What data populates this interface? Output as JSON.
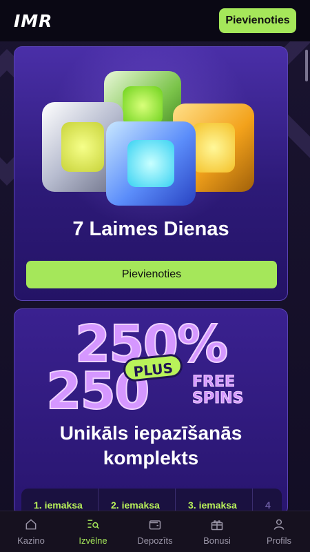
{
  "header": {
    "logo": "IMR",
    "join_label": "Pievienoties"
  },
  "promo1": {
    "title": "7 Laimes Dienas",
    "button_label": "Pievienoties"
  },
  "promo2": {
    "headline_top": "250%",
    "headline_bottom": "250",
    "plus_badge": "PLUS",
    "free_spins_line1": "FREE",
    "free_spins_line2": "SPINS",
    "title_line1": "Unikāls iepazīšanās",
    "title_line2": "komplekts",
    "deposit_tabs": [
      "1. iemaksa",
      "2. iemaksa",
      "3. iemaksa",
      "4"
    ]
  },
  "nav": {
    "items": [
      {
        "label": "Kazino",
        "icon": "home-icon"
      },
      {
        "label": "Izvēlne",
        "icon": "menu-search-icon",
        "active": true
      },
      {
        "label": "Depozīts",
        "icon": "wallet-icon"
      },
      {
        "label": "Bonusi",
        "icon": "gift-icon"
      },
      {
        "label": "Profils",
        "icon": "user-icon"
      }
    ]
  },
  "colors": {
    "accent": "#a5e75a",
    "card_bg": "#2d1a78",
    "headline": "#d597ff"
  }
}
